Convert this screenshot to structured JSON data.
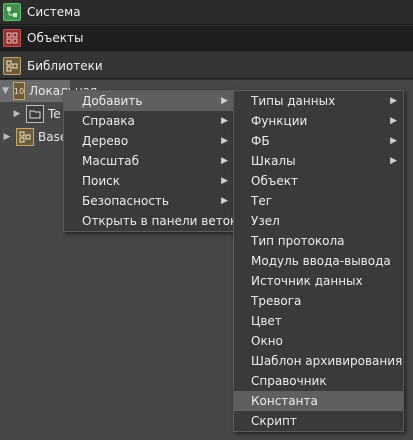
{
  "headers": {
    "system": "Система",
    "objects": "Объекты",
    "libraries": "Библиотеки"
  },
  "tree": {
    "local": "Локальная",
    "te": "Te",
    "base": "Base"
  },
  "context_menu": {
    "items": [
      "Добавить",
      "Справка",
      "Дерево",
      "Масштаб",
      "Поиск",
      "Безопасность",
      "Открыть в панели веток"
    ]
  },
  "add_submenu": {
    "items": [
      "Типы данных",
      "Функции",
      "ФБ",
      "Шкалы",
      "Объект",
      "Тег",
      "Узел",
      "Тип протокола",
      "Модуль ввода-вывода",
      "Источник данных",
      "Тревога",
      "Цвет",
      "Окно",
      "Шаблон архивирования",
      "Справочник",
      "Константа",
      "Скрипт"
    ]
  }
}
